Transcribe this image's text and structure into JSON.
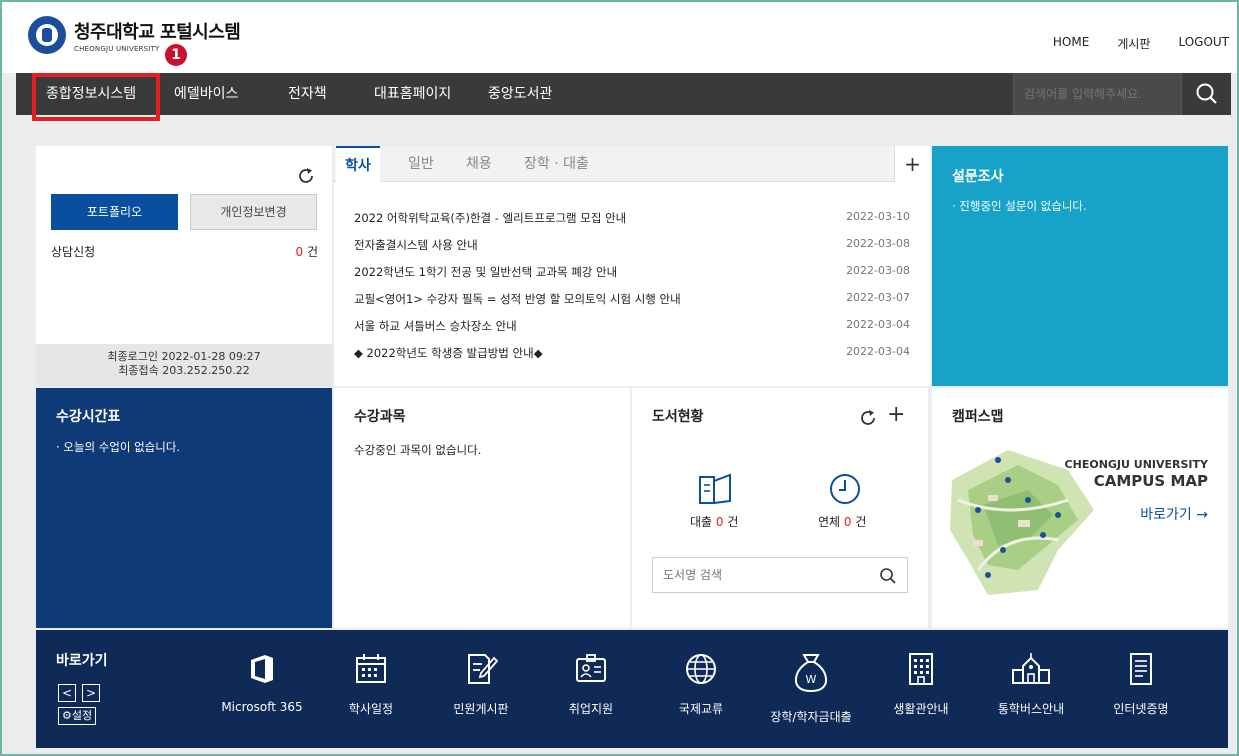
{
  "header": {
    "logo_main": "청주대학교 포털시스템",
    "logo_sub": "CHEONGJU UNIVERSITY",
    "marker": "1",
    "links": [
      "HOME",
      "게시판",
      "LOGOUT"
    ]
  },
  "nav": {
    "items": [
      "종합정보시스템",
      "에델바이스",
      "전자책",
      "대표홈페이지",
      "중앙도서관"
    ],
    "search_placeholder": "검색어를 입력해주세요."
  },
  "profile": {
    "portfolio_button": "포트폴리오",
    "privacy_button": "개인정보변경",
    "consult_label": "상담신청",
    "consult_count": "0",
    "consult_unit": "건",
    "last_login": "최종로그인 2022-01-28 09:27",
    "last_ip": "최종접속 203.252.250.22"
  },
  "news": {
    "tabs": [
      "학사",
      "일반",
      "채용",
      "장학 · 대출"
    ],
    "plus": "+",
    "rows": [
      {
        "title": "2022 어학위탁교육(주)한결 - 엘리트프로그램 모집 안내",
        "date": "2022-03-10"
      },
      {
        "title": "전자출결시스템 사용 안내",
        "date": "2022-03-08"
      },
      {
        "title": "2022학년도 1학기 전공 및 일반선택 교과목 폐강 안내",
        "date": "2022-03-08"
      },
      {
        "title": "교필<영어1> 수강자 필독 = 성적 반영 할 모의토익 시험 시행 안내",
        "date": "2022-03-07"
      },
      {
        "title": "서울 하교 셔틀버스 승차장소 안내",
        "date": "2022-03-04"
      },
      {
        "title": "◆ 2022학년도 학생증 발급방법 안내◆",
        "date": "2022-03-04"
      }
    ]
  },
  "survey": {
    "title": "설문조사",
    "text": "· 진행중인 설문이 없습니다."
  },
  "timetable": {
    "title": "수강시간표",
    "text": "· 오늘의 수업이 없습니다."
  },
  "courses": {
    "title": "수강과목",
    "text": "수강중인 과목이 없습니다."
  },
  "library": {
    "title": "도서현황",
    "loan_label": "대출",
    "loan_count": "0",
    "overdue_label": "연체",
    "overdue_count": "0",
    "unit": "건",
    "search_placeholder": "도서명 검색",
    "plus": "+"
  },
  "campus": {
    "title": "캠퍼스맵",
    "map_line1": "CHEONGJU UNIVERSITY",
    "map_line2": "CAMPUS MAP",
    "map_link": "바로가기 →"
  },
  "quicklinks": {
    "title": "바로가기",
    "prev": "<",
    "next": ">",
    "settings": "⚙설정",
    "items": [
      "Microsoft 365",
      "학사일정",
      "민원게시판",
      "취업지원",
      "국제교류",
      "장학/학자금대출",
      "생활관안내",
      "통학버스안내",
      "인터넷증명"
    ]
  },
  "colors": {
    "brand_blue": "#0a4ea0",
    "navy": "#0f2a56",
    "teal": "#17a2c8",
    "nav_dark": "#3a3a3a",
    "highlight_red": "#e41e24"
  }
}
